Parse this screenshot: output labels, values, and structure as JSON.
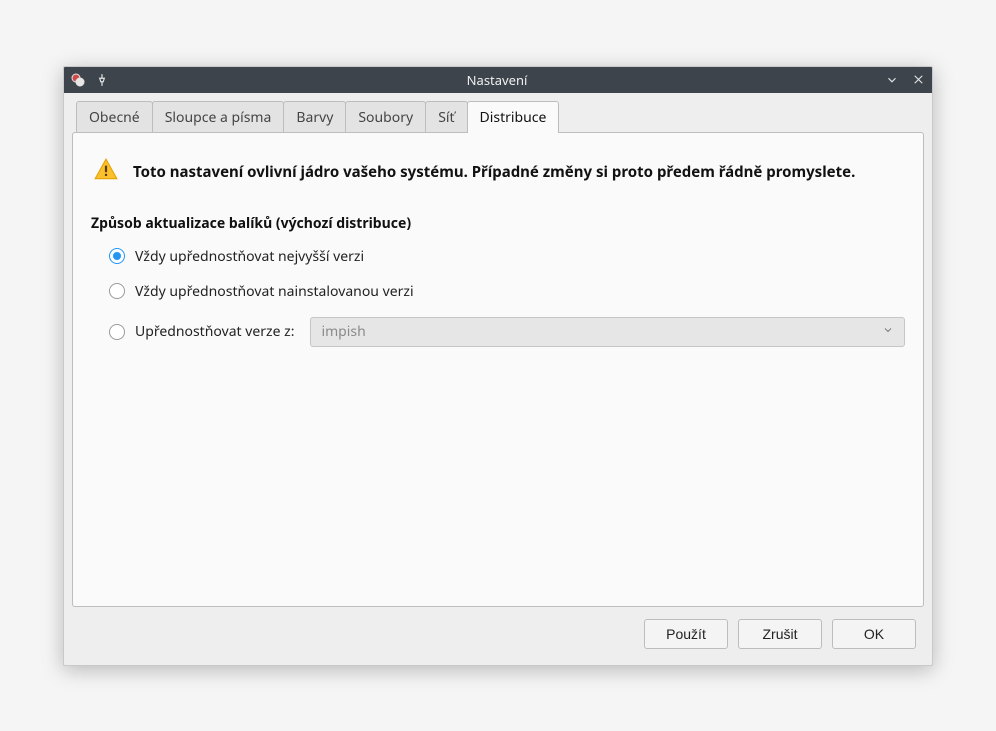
{
  "window": {
    "title": "Nastavení"
  },
  "tabs": {
    "items": [
      {
        "label": "Obecné"
      },
      {
        "label": "Sloupce a písma"
      },
      {
        "label": "Barvy"
      },
      {
        "label": "Soubory"
      },
      {
        "label": "Síť"
      },
      {
        "label": "Distribuce"
      }
    ],
    "active_index": 5
  },
  "panel": {
    "warning": "Toto nastavení ovlivní jádro vašeho systému. Případné změny si proto předem řádně promyslete.",
    "group_label": "Způsob aktualizace balíků (výchozí distribuce)",
    "radios": {
      "option_highest": "Vždy upřednostňovat nejvyšší verzi",
      "option_installed": "Vždy upřednostňovat nainstalovanou verzi",
      "option_from_label": "Upřednostňovat verze z:",
      "selected": "highest"
    },
    "dropdown": {
      "value": "impish",
      "enabled": false
    }
  },
  "footer": {
    "apply": "Použít",
    "cancel": "Zrušit",
    "ok": "OK"
  },
  "icons": {
    "app": "app-icon",
    "pin": "pin-icon",
    "minimize": "chevron-down-icon",
    "close": "close-icon",
    "warning": "alert-triangle-icon",
    "dropdown": "chevron-down-icon"
  }
}
